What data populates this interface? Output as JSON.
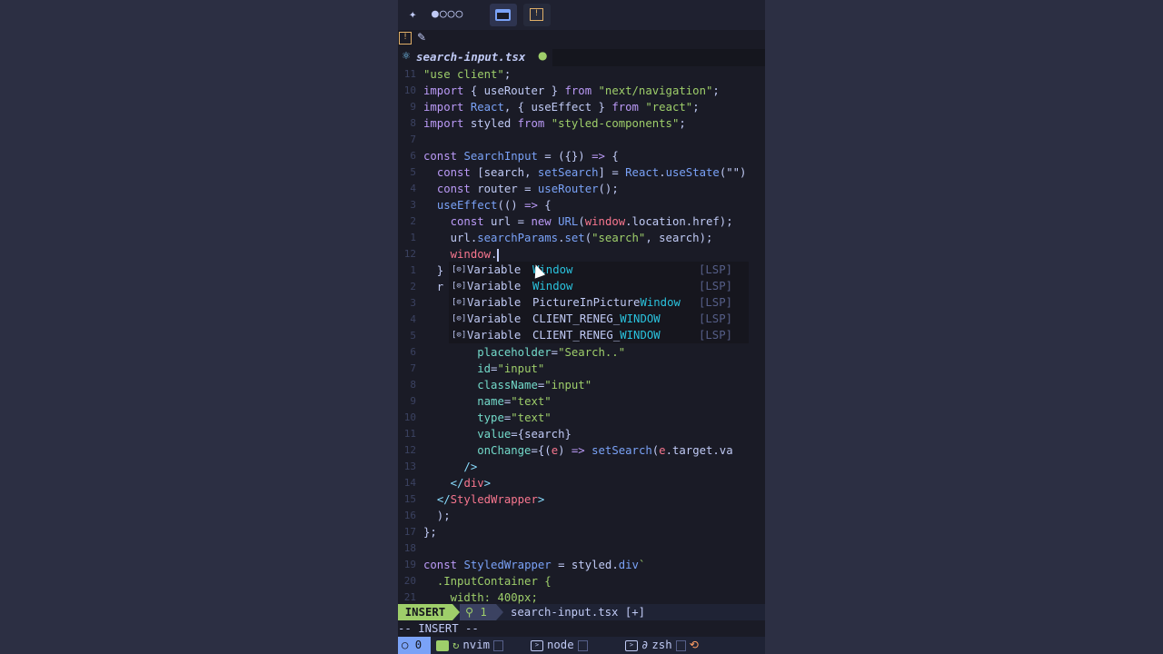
{
  "top_bar": {
    "logo_icon": "sparkle-icon",
    "dots": "●○○○",
    "tabs": [
      {
        "name": "window-tab",
        "icon": "window-icon",
        "active": true
      },
      {
        "name": "warning-tab",
        "icon": "warning-icon",
        "active": false
      }
    ]
  },
  "pin_row": {
    "warn_glyph": "!",
    "pin_glyph": "📌"
  },
  "file_tab": {
    "filename": "search-input.tsx",
    "modified_dot": "●"
  },
  "editor": {
    "lines": [
      {
        "num": "11",
        "segs": [
          [
            "str",
            "\"use client\""
          ],
          [
            "",
            "; "
          ]
        ]
      },
      {
        "num": "10",
        "segs": [
          [
            "kw",
            "import"
          ],
          [
            "",
            " { useRouter } "
          ],
          [
            "kw",
            "from"
          ],
          [
            "",
            " "
          ],
          [
            "str",
            "\"next/navigation\""
          ],
          [
            "",
            ";"
          ]
        ]
      },
      {
        "num": "9",
        "segs": [
          [
            "kw",
            "import"
          ],
          [
            "",
            " "
          ],
          [
            "fn",
            "React"
          ],
          [
            "",
            ", { useEffect } "
          ],
          [
            "kw",
            "from"
          ],
          [
            "",
            " "
          ],
          [
            "str",
            "\"react\""
          ],
          [
            "",
            ";"
          ]
        ]
      },
      {
        "num": "8",
        "segs": [
          [
            "kw",
            "import"
          ],
          [
            "",
            " styled "
          ],
          [
            "kw",
            "from"
          ],
          [
            "",
            " "
          ],
          [
            "str",
            "\"styled-components\""
          ],
          [
            "",
            ";"
          ]
        ]
      },
      {
        "num": "7",
        "segs": []
      },
      {
        "num": "6",
        "segs": [
          [
            "kw",
            "const"
          ],
          [
            "",
            " "
          ],
          [
            "fn",
            "SearchInput"
          ],
          [
            "",
            " = ({}) "
          ],
          [
            "kw",
            "=>"
          ],
          [
            "",
            " {"
          ]
        ]
      },
      {
        "num": "5",
        "segs": [
          [
            "",
            "  "
          ],
          [
            "kw",
            "const"
          ],
          [
            "",
            " [search, "
          ],
          [
            "fn",
            "setSearch"
          ],
          [
            "",
            "] = "
          ],
          [
            "fn",
            "React"
          ],
          [
            "",
            "."
          ],
          [
            "fn",
            "useState"
          ],
          [
            "",
            "(\"\")"
          ]
        ]
      },
      {
        "num": "4",
        "segs": [
          [
            "",
            "  "
          ],
          [
            "kw",
            "const"
          ],
          [
            "",
            " router = "
          ],
          [
            "fn",
            "useRouter"
          ],
          [
            "",
            "();"
          ]
        ]
      },
      {
        "num": "3",
        "segs": [
          [
            "",
            "  "
          ],
          [
            "fn",
            "useEffect"
          ],
          [
            "",
            "(() "
          ],
          [
            "kw",
            "=>"
          ],
          [
            "",
            " {"
          ]
        ]
      },
      {
        "num": "2",
        "segs": [
          [
            "",
            "    "
          ],
          [
            "kw",
            "const"
          ],
          [
            "",
            " url = "
          ],
          [
            "kw",
            "new"
          ],
          [
            "",
            " "
          ],
          [
            "fn",
            "URL"
          ],
          [
            "",
            "("
          ],
          [
            "var",
            "window"
          ],
          [
            "",
            ".location.href);"
          ]
        ]
      },
      {
        "num": "1",
        "segs": [
          [
            "",
            "    url."
          ],
          [
            "fn",
            "searchParams"
          ],
          [
            "",
            "."
          ],
          [
            "fn",
            "set"
          ],
          [
            "",
            "("
          ],
          [
            "str",
            "\"search\""
          ],
          [
            "",
            ", search);"
          ]
        ]
      },
      {
        "num": "12",
        "segs": [
          [
            "",
            "    "
          ],
          [
            "var",
            "window"
          ],
          [
            "",
            "."
          ]
        ],
        "cursor": true
      },
      {
        "num": "1",
        "segs": [
          [
            "",
            "  } "
          ]
        ]
      },
      {
        "num": "2",
        "segs": [
          [
            "",
            "  r"
          ]
        ]
      },
      {
        "num": "3",
        "segs": []
      },
      {
        "num": "4",
        "segs": []
      },
      {
        "num": "5",
        "segs": []
      },
      {
        "num": "6",
        "segs": [
          [
            "",
            "        "
          ],
          [
            "prop",
            "placeholder"
          ],
          [
            "",
            "="
          ],
          [
            "str",
            "\"Search..\""
          ]
        ]
      },
      {
        "num": "7",
        "segs": [
          [
            "",
            "        "
          ],
          [
            "prop",
            "id"
          ],
          [
            "",
            "="
          ],
          [
            "str",
            "\"input\""
          ]
        ]
      },
      {
        "num": "8",
        "segs": [
          [
            "",
            "        "
          ],
          [
            "prop",
            "className"
          ],
          [
            "",
            "="
          ],
          [
            "str",
            "\"input\""
          ]
        ]
      },
      {
        "num": "9",
        "segs": [
          [
            "",
            "        "
          ],
          [
            "prop",
            "name"
          ],
          [
            "",
            "="
          ],
          [
            "str",
            "\"text\""
          ]
        ]
      },
      {
        "num": "10",
        "segs": [
          [
            "",
            "        "
          ],
          [
            "prop",
            "type"
          ],
          [
            "",
            "="
          ],
          [
            "str",
            "\"text\""
          ]
        ]
      },
      {
        "num": "11",
        "segs": [
          [
            "",
            "        "
          ],
          [
            "prop",
            "value"
          ],
          [
            "",
            "={search}"
          ]
        ]
      },
      {
        "num": "12",
        "segs": [
          [
            "",
            "        "
          ],
          [
            "prop",
            "onChange"
          ],
          [
            "",
            "={("
          ],
          [
            "var",
            "e"
          ],
          [
            "",
            ") "
          ],
          [
            "kw",
            "=>"
          ],
          [
            "",
            " "
          ],
          [
            "fn",
            "setSearch"
          ],
          [
            "",
            "("
          ],
          [
            "var",
            "e"
          ],
          [
            "",
            ".target.va"
          ]
        ]
      },
      {
        "num": "13",
        "segs": [
          [
            "",
            "      "
          ],
          [
            "punc",
            "/>"
          ]
        ]
      },
      {
        "num": "14",
        "segs": [
          [
            "",
            "    "
          ],
          [
            "punc",
            "</"
          ],
          [
            "tag",
            "div"
          ],
          [
            "punc",
            ">"
          ]
        ]
      },
      {
        "num": "15",
        "segs": [
          [
            "",
            "  "
          ],
          [
            "punc",
            "</"
          ],
          [
            "tag",
            "StyledWrapper"
          ],
          [
            "punc",
            ">"
          ]
        ]
      },
      {
        "num": "16",
        "segs": [
          [
            "",
            "  );"
          ]
        ]
      },
      {
        "num": "17",
        "segs": [
          [
            "",
            "};"
          ]
        ]
      },
      {
        "num": "18",
        "segs": []
      },
      {
        "num": "19",
        "segs": [
          [
            "kw",
            "const"
          ],
          [
            "",
            " "
          ],
          [
            "fn",
            "StyledWrapper"
          ],
          [
            "",
            " = styled."
          ],
          [
            "fn",
            "div"
          ],
          [
            "str",
            "`"
          ]
        ]
      },
      {
        "num": "20",
        "segs": [
          [
            "",
            "  "
          ],
          [
            "str",
            ".InputContainer {"
          ]
        ]
      },
      {
        "num": "21",
        "segs": [
          [
            "",
            "    "
          ],
          [
            "str",
            "width: 400px;"
          ]
        ]
      }
    ]
  },
  "completion": {
    "items": [
      {
        "icon": "[⊙]",
        "kind": "Variable",
        "prefix": "",
        "match": "Window",
        "source": "[LSP]"
      },
      {
        "icon": "[⊙]",
        "kind": "Variable",
        "prefix": "",
        "match": "Window",
        "source": "[LSP]"
      },
      {
        "icon": "[⊙]",
        "kind": "Variable",
        "prefix": "PictureInPicture",
        "match": "Window",
        "source": "[LSP]"
      },
      {
        "icon": "[⊙]",
        "kind": "Variable",
        "prefix": "CLIENT_RENEG_",
        "match": "WINDOW",
        "source": "[LSP]"
      },
      {
        "icon": "[⊙]",
        "kind": "Variable",
        "prefix": "CLIENT_RENEG_",
        "match": "WINDOW",
        "source": "[LSP]"
      }
    ]
  },
  "statusline": {
    "mode": "INSERT",
    "diagnostics": "⚲ 1",
    "file": "search-input.tsx [+]"
  },
  "cmdline": {
    "text": "-- INSERT --"
  },
  "tmux": {
    "session": "○ 0",
    "windows": [
      {
        "label": "nvim",
        "active": true
      },
      {
        "label": "node",
        "active": false
      },
      {
        "label": "zsh",
        "active": false
      }
    ]
  },
  "colors": {
    "accent": "#7aa2f7",
    "insert_mode": "#9ece6a",
    "background": "#1a1b26",
    "outer": "#2c2f43"
  }
}
